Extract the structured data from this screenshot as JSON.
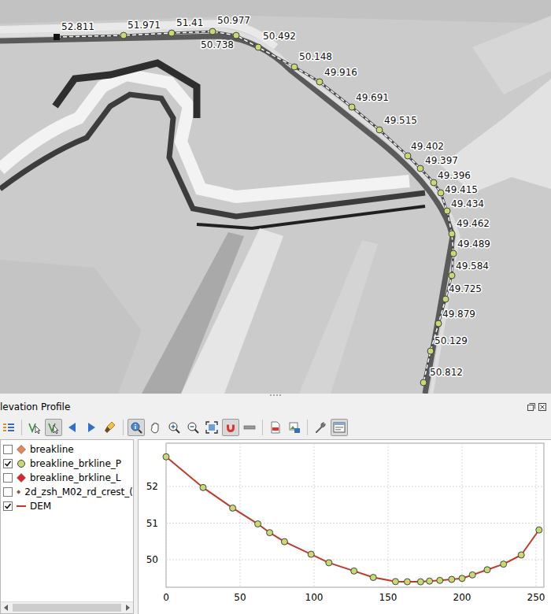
{
  "map": {
    "points": [
      {
        "label": "52.811",
        "kind": "start"
      },
      {
        "label": "51.971",
        "kind": "point"
      },
      {
        "label": "51.41",
        "kind": "point"
      },
      {
        "label": "50.977",
        "kind": "point"
      },
      {
        "label": "50.738",
        "kind": "point"
      },
      {
        "label": "50.492",
        "kind": "point"
      },
      {
        "label": "50.148",
        "kind": "point"
      },
      {
        "label": "49.916",
        "kind": "point"
      },
      {
        "label": "49.691",
        "kind": "point"
      },
      {
        "label": "49.515",
        "kind": "point"
      },
      {
        "label": "49.402",
        "kind": "point"
      },
      {
        "label": "49.397",
        "kind": "point"
      },
      {
        "label": "49.396",
        "kind": "point"
      },
      {
        "label": "49.415",
        "kind": "point"
      },
      {
        "label": "49.434",
        "kind": "point"
      },
      {
        "label": "49.462",
        "kind": "point"
      },
      {
        "label": "49.489",
        "kind": "point"
      },
      {
        "label": "49.584",
        "kind": "point"
      },
      {
        "label": "49.725",
        "kind": "point"
      },
      {
        "label": "49.879",
        "kind": "point"
      },
      {
        "label": "50.129",
        "kind": "point"
      },
      {
        "label": "50.812",
        "kind": "point"
      }
    ]
  },
  "panel": {
    "title": "levation Profile"
  },
  "toolbar": [
    {
      "pressed": false
    },
    {
      "pressed": false
    },
    {
      "pressed": true
    },
    {
      "pressed": false
    },
    {
      "pressed": false
    },
    {
      "pressed": false
    },
    {
      "pressed": true
    },
    {
      "pressed": false
    },
    {
      "pressed": false
    },
    {
      "pressed": false
    },
    {
      "pressed": false
    },
    {
      "pressed": true
    },
    {
      "pressed": false
    },
    {
      "pressed": false
    },
    {
      "pressed": false
    },
    {
      "pressed": false
    },
    {
      "pressed": true
    }
  ],
  "layers": [
    {
      "name": "breakline",
      "checked": false,
      "kind": "diamond",
      "color": "#e8835a"
    },
    {
      "name": "breakline_brkline_P",
      "checked": true,
      "kind": "circle",
      "color": "#c8d96f"
    },
    {
      "name": "breakline_brkline_L",
      "checked": false,
      "kind": "diamond",
      "color": "#d9262c"
    },
    {
      "name": "2d_zsh_M02_rd_crest_(",
      "checked": false,
      "kind": "diamond",
      "color": "#8b5a3c"
    },
    {
      "name": "DEM",
      "checked": true,
      "kind": "line",
      "color": "#c0392b"
    }
  ],
  "chart": {
    "y_ticks": [
      "52",
      "51",
      "50"
    ],
    "x_ticks": [
      "0",
      "50",
      "100",
      "150",
      "200",
      "250"
    ],
    "distances": [
      0,
      25,
      45,
      62,
      70,
      80,
      98,
      110,
      127,
      140,
      155,
      163,
      172,
      178,
      185,
      193,
      200,
      207,
      217,
      228,
      240,
      252
    ],
    "points": [
      52.811,
      51.971,
      51.41,
      50.977,
      50.738,
      50.492,
      50.148,
      49.916,
      49.691,
      49.515,
      49.402,
      49.397,
      49.396,
      49.415,
      49.434,
      49.462,
      49.489,
      49.584,
      49.725,
      49.879,
      50.129,
      50.812
    ],
    "dem": [
      52.811,
      51.971,
      51.41,
      50.977,
      50.738,
      50.492,
      50.148,
      49.916,
      49.691,
      49.515,
      49.402,
      49.397,
      49.396,
      49.415,
      49.434,
      49.462,
      49.489,
      49.584,
      49.725,
      49.879,
      50.129,
      50.812
    ]
  }
}
